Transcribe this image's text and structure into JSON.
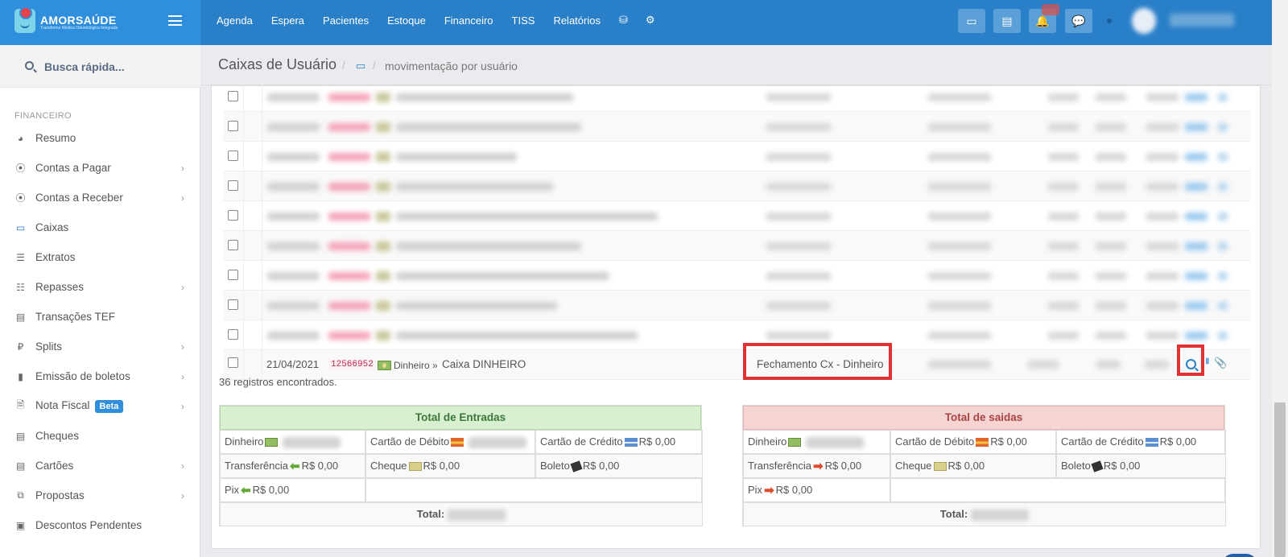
{
  "brand": {
    "name": "AMORSAÚDE",
    "tagline": "Transforme Médica Odontológica Integrada"
  },
  "topnav": {
    "items": [
      "Agenda",
      "Espera",
      "Pacientes",
      "Estoque",
      "Financeiro",
      "TISS",
      "Relatórios"
    ],
    "icons": [
      "database-icon",
      "gear-icon"
    ]
  },
  "topbar_buttons": [
    "inbox-icon",
    "list-icon",
    "bell-icon",
    "chat-icon"
  ],
  "search": {
    "placeholder": "Busca rápida..."
  },
  "sidebar": {
    "section": "FINANCEIRO",
    "items": [
      {
        "label": "Resumo",
        "icon": "pie-chart-icon",
        "chevron": false
      },
      {
        "label": "Contas a Pagar",
        "icon": "arrow-up-circle-icon",
        "chevron": true
      },
      {
        "label": "Contas a Receber",
        "icon": "arrow-down-circle-icon",
        "chevron": true
      },
      {
        "label": "Caixas",
        "icon": "inbox-icon",
        "chevron": false
      },
      {
        "label": "Extratos",
        "icon": "list-icon",
        "chevron": false
      },
      {
        "label": "Repasses",
        "icon": "sitemap-icon",
        "chevron": true
      },
      {
        "label": "Transações TEF",
        "icon": "credit-card-icon",
        "chevron": false
      },
      {
        "label": "Splits",
        "icon": "ruble-icon",
        "chevron": true
      },
      {
        "label": "Emissão de boletos",
        "icon": "barcode-icon",
        "chevron": true
      },
      {
        "label": "Nota Fiscal",
        "icon": "file-icon",
        "chevron": true,
        "badge": "Beta"
      },
      {
        "label": "Cheques",
        "icon": "cheque-icon",
        "chevron": false
      },
      {
        "label": "Cartões",
        "icon": "card-icon",
        "chevron": true
      },
      {
        "label": "Propostas",
        "icon": "copy-icon",
        "chevron": true
      },
      {
        "label": "Descontos Pendentes",
        "icon": "money-icon",
        "chevron": false
      }
    ]
  },
  "header": {
    "title": "Caixas de Usuário",
    "breadcrumb_icon": "inbox-icon",
    "breadcrumb": "movimentação por usuário"
  },
  "table": {
    "last_row": {
      "date": "21/04/2021",
      "code": "12566952",
      "payment": "Dinheiro »",
      "account": "Caixa DINHEIRO",
      "category": "Fechamento Cx - Dinheiro"
    },
    "records": "36 registros encontrados."
  },
  "entradas": {
    "title": "Total de Entradas",
    "dinheiro": "Dinheiro",
    "debito": "Cartão de Débito",
    "credito": "Cartão de Crédito",
    "credito_val": "R$ 0,00",
    "transferencia": "Transferência",
    "transferencia_val": "R$ 0,00",
    "cheque": "Cheque",
    "cheque_val": "R$ 0,00",
    "boleto": "Boleto",
    "boleto_val": "R$ 0,00",
    "pix": "Pix",
    "pix_val": "R$ 0,00",
    "total": "Total:"
  },
  "saidas": {
    "title": "Total de saidas",
    "dinheiro": "Dinheiro",
    "debito": "Cartão de Débito",
    "debito_val": "R$ 0,00",
    "credito": "Cartão de Crédito",
    "credito_val": "R$ 0,00",
    "transferencia": "Transferência",
    "transferencia_val": "R$ 0,00",
    "cheque": "Cheque",
    "cheque_val": "R$ 0,00",
    "boleto": "Boleto",
    "boleto_val": "R$ 0,00",
    "pix": "Pix",
    "pix_val": "R$ 0,00",
    "total": "Total:"
  },
  "colors": {
    "primary": "#2a80c8",
    "highlight": "#e03232"
  }
}
